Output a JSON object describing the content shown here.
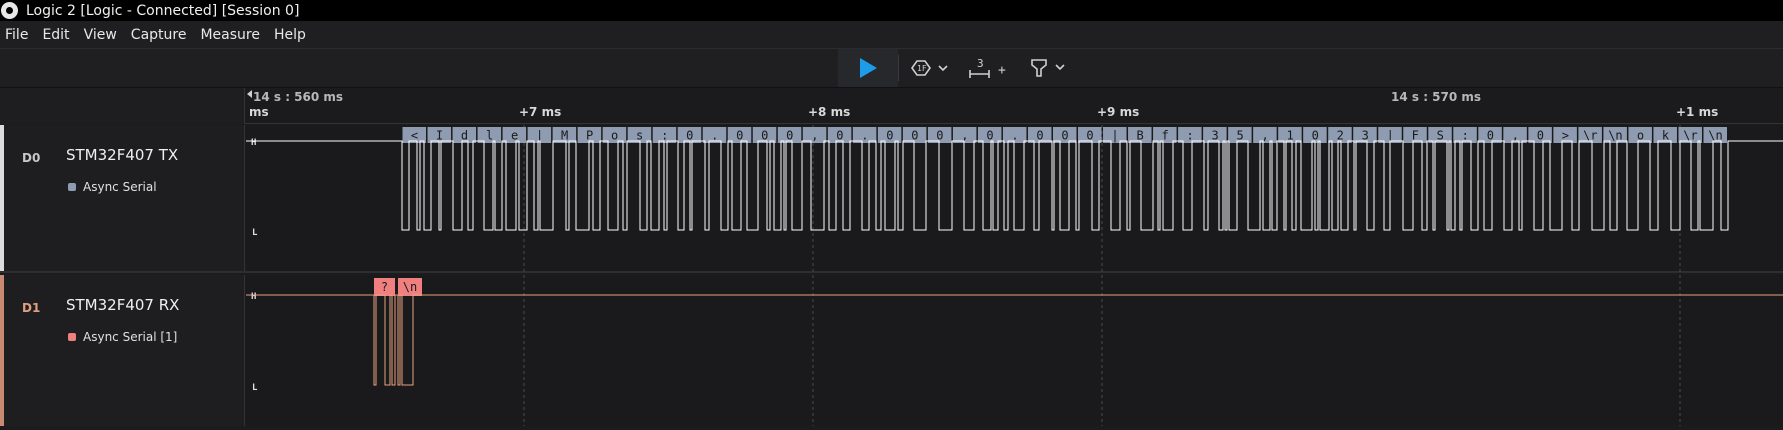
{
  "window": {
    "title": "Logic 2 [Logic - Connected] [Session 0]"
  },
  "menu": [
    "File",
    "Edit",
    "View",
    "Capture",
    "Measure",
    "Help"
  ],
  "toolbar": {
    "play_icon": "play-icon",
    "trigger_icon": "trigger-icon",
    "measure_icon": "measure-icon",
    "marker_icon": "marker-icon",
    "measure_badge": "3",
    "measure_plus": "+",
    "accent_color": "#1e9be9"
  },
  "ruler": {
    "start_label": "14 s : 560 ms",
    "start_unit": "ms",
    "mid_label": "14 s : 570 ms",
    "ticks": [
      "+7 ms",
      "+8 ms",
      "+9 ms",
      "+1 ms"
    ]
  },
  "channels": [
    {
      "id": "D0",
      "name": "STM32F407 TX",
      "analyzer": "Async Serial",
      "color": "#ffffff",
      "analyzer_color": "#8e9bb0",
      "high_label": "H",
      "low_label": "L",
      "decoded": [
        "<",
        "I",
        "d",
        "l",
        "e",
        "|",
        "M",
        "P",
        "o",
        "s",
        ":",
        "0",
        ".",
        "0",
        "0",
        "0",
        ",",
        "0",
        ".",
        "0",
        "0",
        "0",
        ",",
        "0",
        ".",
        "0",
        "0",
        "0",
        "|",
        "B",
        "f",
        ":",
        "3",
        "5",
        ",",
        "1",
        "0",
        "2",
        "3",
        "|",
        "F",
        "S",
        ":",
        "0",
        ",",
        "0",
        ">",
        "\\r",
        "\\n",
        "o",
        "k",
        "\\r",
        "\\n"
      ]
    },
    {
      "id": "D1",
      "name": "STM32F407 RX",
      "analyzer": "Async Serial [1]",
      "color": "#e8a080",
      "analyzer_color": "#f08080",
      "high_label": "H",
      "low_label": "L",
      "decoded": [
        "?",
        "\\n"
      ]
    }
  ]
}
